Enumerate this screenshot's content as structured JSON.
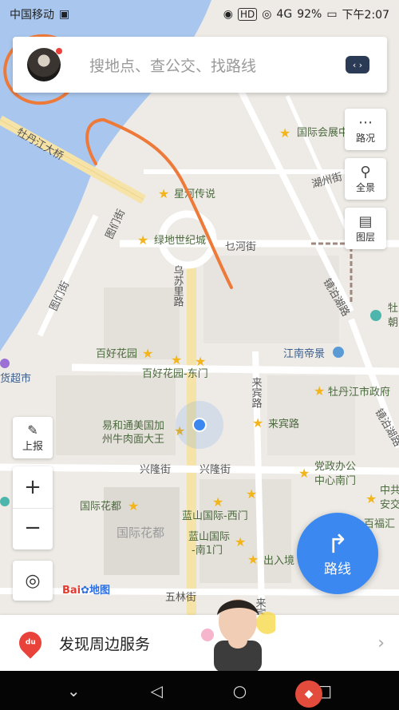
{
  "status": {
    "carrier": "中国移动",
    "hd": "HD",
    "signal": "4G",
    "battery": "92%",
    "time": "下午2:07"
  },
  "search": {
    "placeholder": "搜地点、查公交、找路线"
  },
  "right_tools": [
    {
      "label": "路况",
      "icon": "traffic-icon"
    },
    {
      "label": "全景",
      "icon": "panorama-icon"
    },
    {
      "label": "图层",
      "icon": "layers-icon"
    }
  ],
  "left_tools": {
    "report_label": "上报",
    "zoom_in": "+",
    "zoom_out": "−"
  },
  "route_button": {
    "label": "路线"
  },
  "baidu_logo": {
    "brand": "Bai",
    "suffix": "地图"
  },
  "banner": {
    "text": "发现周边服务",
    "badge": "du"
  },
  "map": {
    "roads": {
      "bridge": "牡丹江大桥",
      "wusuli": "乌苏里路",
      "tumen": "图们街",
      "baohe": "乜河街",
      "hubei": "湖州街",
      "jingbo": "镜泊湖路",
      "laibin": "来宾路",
      "laibin2": "来宾路",
      "xinglong1": "兴隆街",
      "xinglong2": "兴隆街",
      "wulin": "五林街",
      "laibin3": "来宾"
    },
    "pois": {
      "guojihuizhan": "国际会展中",
      "xinghe": "星河传说",
      "lvdi": "绿地世纪城",
      "baihao": "百好花园",
      "baihao_east": "百好花园-东门",
      "jiangnan": "江南帝景",
      "gov": "牡丹江市政府",
      "laibin_poi": "来宾路",
      "yihetong1": "易和通美国加",
      "yihetong2": "州牛肉面大王",
      "dangzheng1": "党政办公",
      "dangzheng2": "中心南门",
      "guojihuadu": "国际花都",
      "guojihuadu_area": "国际花都",
      "lanshan_west": "蓝山国际-西门",
      "lanshan1": "蓝山国际",
      "lanshan2": "-南1门",
      "churujing": "出入境",
      "zhongban": "中共",
      "anquan": "安交",
      "baifuhui": "百福汇",
      "mudan_chao": "牡",
      "chao2": "朝",
      "baihuo": "货超市"
    }
  }
}
